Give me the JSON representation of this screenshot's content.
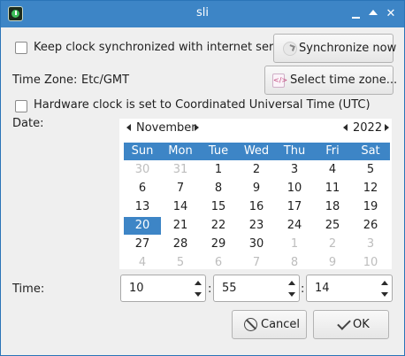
{
  "window": {
    "title": "sli"
  },
  "sync": {
    "checkbox_label": "Keep clock synchronized with internet servers",
    "button_label": "Synchronize now"
  },
  "timezone": {
    "label": "Time Zone:",
    "value": "Etc/GMT",
    "button_label": "Select time zone..."
  },
  "utc": {
    "checkbox_label": "Hardware clock is set to Coordinated Universal Time (UTC)"
  },
  "date": {
    "label": "Date:",
    "month": "November",
    "year": "2022",
    "weekdays": [
      "Sun",
      "Mon",
      "Tue",
      "Wed",
      "Thu",
      "Fri",
      "Sat"
    ],
    "weeks": [
      [
        "30",
        "31",
        "1",
        "2",
        "3",
        "4",
        "5"
      ],
      [
        "6",
        "7",
        "8",
        "9",
        "10",
        "11",
        "12"
      ],
      [
        "13",
        "14",
        "15",
        "16",
        "17",
        "18",
        "19"
      ],
      [
        "20",
        "21",
        "22",
        "23",
        "24",
        "25",
        "26"
      ],
      [
        "27",
        "28",
        "29",
        "30",
        "1",
        "2",
        "3"
      ],
      [
        "4",
        "5",
        "6",
        "7",
        "8",
        "9",
        "10"
      ]
    ],
    "selected_day": "20"
  },
  "time": {
    "label": "Time:",
    "hours": "10",
    "minutes": "55",
    "seconds": "14",
    "separator": ":"
  },
  "actions": {
    "cancel_label": "Cancel",
    "ok_label": "OK"
  },
  "colors": {
    "accent": "#3d85c6",
    "muted_day": "#bdbdbd"
  }
}
